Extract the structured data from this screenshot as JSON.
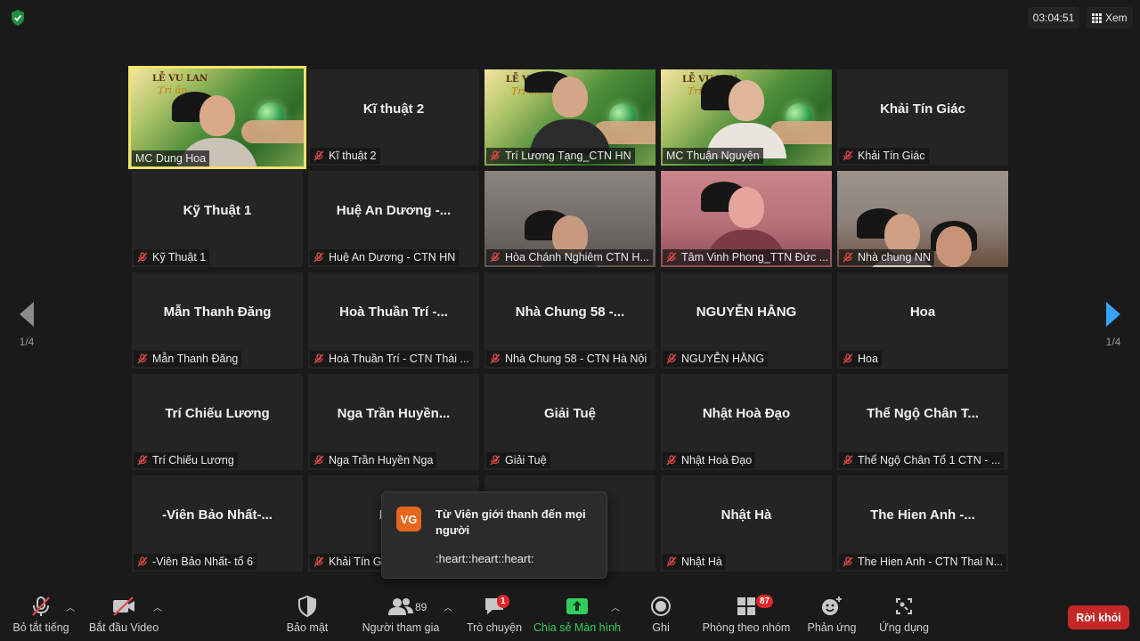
{
  "header": {
    "timer": "03:04:51",
    "view_label": "Xem"
  },
  "pagination": {
    "left": "1/4",
    "right": "1/4"
  },
  "video_banner": {
    "line1": "LỄ VU LAN",
    "line2": "Tri ân..."
  },
  "tiles": [
    {
      "center": "",
      "label": "MC Dung Hoa",
      "muted": false,
      "active": true,
      "video": "banner-woman"
    },
    {
      "center": "Kĩ thuật 2",
      "label": "Kĩ thuật 2",
      "muted": true
    },
    {
      "center": "",
      "label": "Trí Lương Tạng_CTN HN",
      "muted": true,
      "video": "banner-man"
    },
    {
      "center": "",
      "label": "MC Thuận Nguyện",
      "muted": false,
      "video": "banner-girl"
    },
    {
      "center": "Khải Tín Giác",
      "label": "Khải Tín Giác",
      "muted": true
    },
    {
      "center": "Kỹ Thuật 1",
      "label": "Kỹ Thuật 1",
      "muted": true
    },
    {
      "center": "Huệ An Dương -...",
      "label": "Huệ An Dương - CTN HN",
      "muted": true
    },
    {
      "center": "",
      "label": "Hòa Chánh Nghiêm CTN H...",
      "muted": true,
      "video": "room-1"
    },
    {
      "center": "",
      "label": "Tâm Vinh Phong_TTN Đức ...",
      "muted": true,
      "video": "room-2"
    },
    {
      "center": "",
      "label": "Nhà chung NN",
      "muted": true,
      "video": "room-3"
    },
    {
      "center": "Mẫn Thanh Đăng",
      "label": "Mẫn Thanh Đăng",
      "muted": true
    },
    {
      "center": "Hoà Thuần Trí -...",
      "label": "Hoà Thuần Trí - CTN Thái ...",
      "muted": true
    },
    {
      "center": "Nhà Chung 58 -...",
      "label": "Nhà Chung 58 - CTN Hà Nội",
      "muted": true
    },
    {
      "center": "NGUYỄN HẰNG",
      "label": "NGUYỄN HẰNG",
      "muted": true
    },
    {
      "center": "Hoa",
      "label": "Hoa",
      "muted": true
    },
    {
      "center": "Trí Chiếu Lương",
      "label": "Trí Chiếu Lương",
      "muted": true
    },
    {
      "center": "Nga Trần Huyền...",
      "label": "Nga Trần Huyền Nga",
      "muted": true
    },
    {
      "center": "Giải Tuệ",
      "label": "Giải Tuệ",
      "muted": true
    },
    {
      "center": "Nhật Hoà Đạo",
      "label": "Nhật Hoà Đạo",
      "muted": true
    },
    {
      "center": "Thể Ngộ Chân T...",
      "label": "Thể Ngộ Chân Tổ 1 CTN - ...",
      "muted": true
    },
    {
      "center": "-Viên Bảo Nhất-...",
      "label": "-Viên Bảo Nhất- tổ 6",
      "muted": true
    },
    {
      "center": "Khải",
      "label": "Khải Tín G",
      "muted": true
    },
    {
      "center": "...ệ...",
      "label": "ên)CTN...",
      "muted": true
    },
    {
      "center": "Nhật Hà",
      "label": "Nhật Hà",
      "muted": true
    },
    {
      "center": "The Hien Anh -...",
      "label": "The Hien Anh - CTN Thai N...",
      "muted": true
    }
  ],
  "chat_toast": {
    "avatar_initials": "VG",
    "avatar_color": "#e8671e",
    "title": "Từ Viên giới thanh đến mọi người",
    "message": ":heart::heart::heart:"
  },
  "toolbar": {
    "mute_label": "Bỏ tắt tiếng",
    "video_label": "Bắt đầu Video",
    "security_label": "Bảo mật",
    "participants_label": "Người tham gia",
    "participants_count": "89",
    "chat_label": "Trò chuyện",
    "chat_badge": "1",
    "share_label": "Chia sẻ Màn hình",
    "record_label": "Ghi",
    "breakout_label": "Phòng theo nhóm",
    "breakout_badge": "87",
    "reactions_label": "Phản ứng",
    "apps_label": "Ứng dụng",
    "leave_label": "Rời khỏi"
  },
  "colors": {
    "active_speaker_border": "#f3e26a",
    "share_green": "#2fcf5d",
    "leave_red": "#c62828",
    "badge_red": "#e02828",
    "nav_arrow_blue": "#36a3ff",
    "muted_red": "#e04848"
  }
}
